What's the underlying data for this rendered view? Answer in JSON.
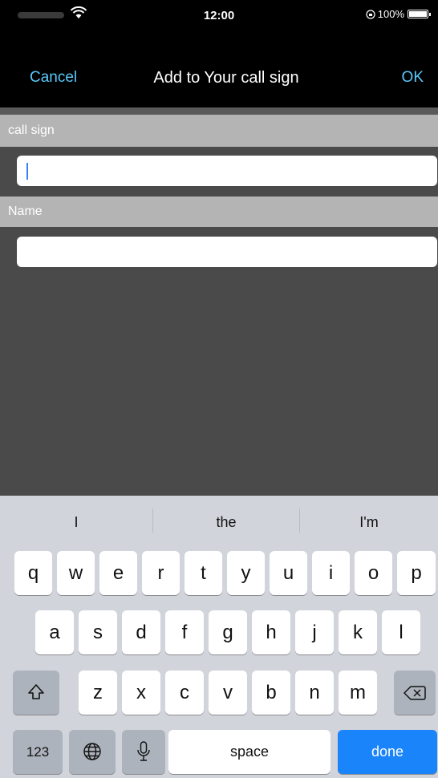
{
  "status_bar": {
    "time": "12:00",
    "battery_text": "100%",
    "battery_level": 1.0,
    "icons": [
      "wifi-icon",
      "lock-rotation-icon",
      "battery-icon"
    ]
  },
  "nav": {
    "cancel": "Cancel",
    "title": "Add to Your call sign",
    "ok": "OK"
  },
  "form": {
    "callsign_header": "call sign",
    "callsign_value": "",
    "name_header": "Name",
    "name_value": ""
  },
  "keyboard": {
    "suggestions": [
      "I",
      "the",
      "I'm"
    ],
    "row1": [
      "q",
      "w",
      "e",
      "r",
      "t",
      "y",
      "u",
      "i",
      "o",
      "p"
    ],
    "row2": [
      "a",
      "s",
      "d",
      "f",
      "g",
      "h",
      "j",
      "k",
      "l"
    ],
    "row3": [
      "z",
      "x",
      "c",
      "v",
      "b",
      "n",
      "m"
    ],
    "numbers_key": "123",
    "space_key": "space",
    "done_key": "done"
  },
  "colors": {
    "accent": "#5ac8fa",
    "done_key": "#1a84fb",
    "background": "#4a4a4a"
  }
}
